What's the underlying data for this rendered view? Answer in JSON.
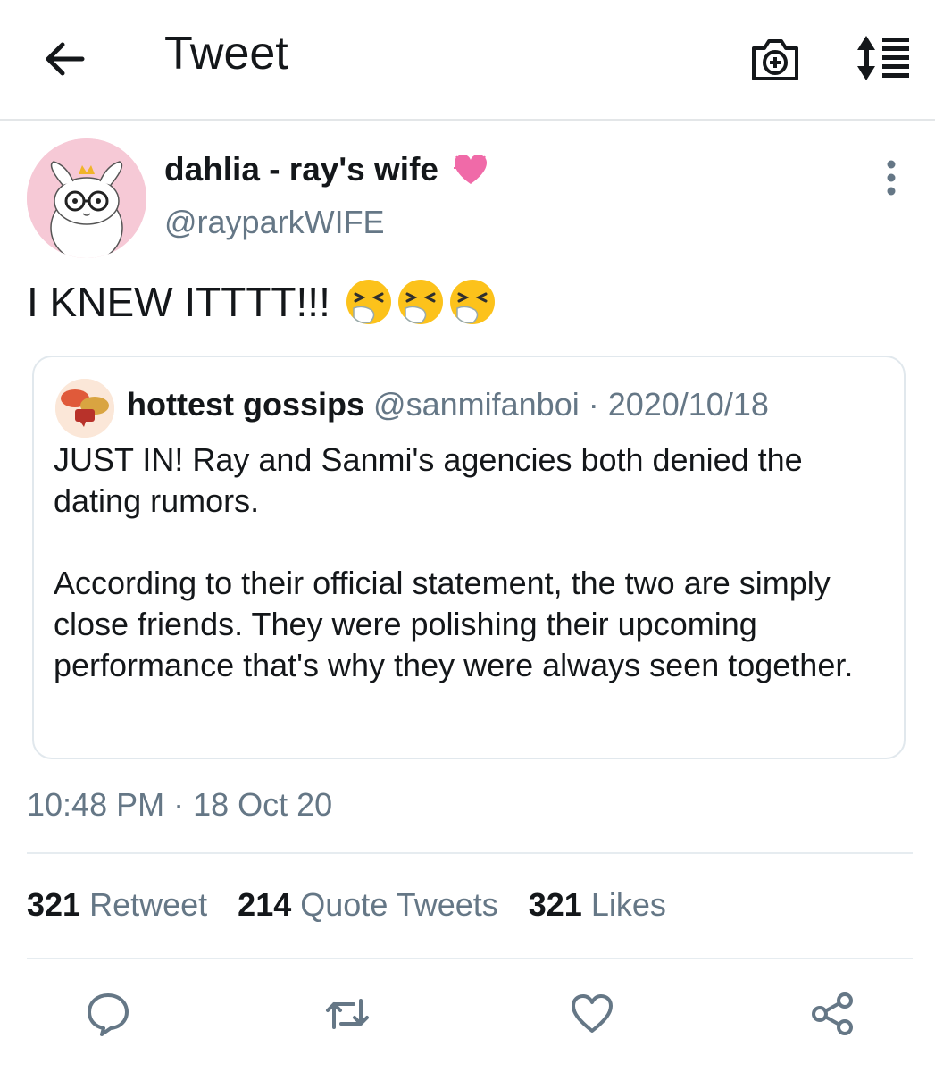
{
  "header": {
    "title": "Tweet",
    "back_icon": "arrow-left-icon",
    "camera_icon": "camera-add-icon",
    "sort_icon": "sort-list-icon"
  },
  "tweet": {
    "author_name": "dahlia - ray's wife",
    "author_handle": "@rayparkWIFE",
    "text": "I KNEW ITTTT!!!",
    "emoji_count": 3,
    "timestamp": "10:48 PM · 18 Oct 20"
  },
  "quoted": {
    "name": "hottest gossips",
    "handle_date": "@sanmifanboi · 2020/10/18",
    "paragraph1": "JUST IN! Ray and Sanmi's agencies both denied the dating rumors.",
    "paragraph2": "According to their official statement, the two are simply close friends. They were polishing their upcoming performance that's why they were always seen together."
  },
  "stats": {
    "retweets": "321",
    "retweets_label": "Retweet",
    "quotes": "214",
    "quotes_label": "Quote Tweets",
    "likes": "321",
    "likes_label": "Likes"
  },
  "colors": {
    "text": "#14171a",
    "secondary": "#657786",
    "border": "#e1e8ed",
    "avatar_bg": "#f6c9d6"
  }
}
